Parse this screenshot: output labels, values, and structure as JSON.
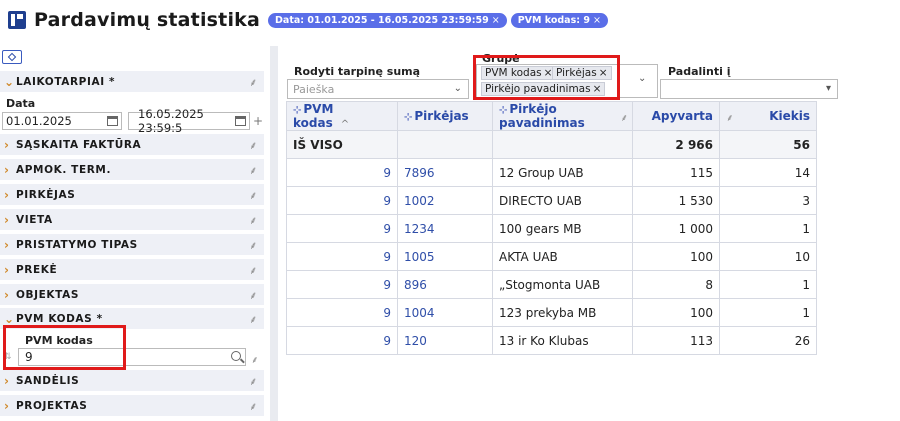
{
  "header": {
    "title": "Pardavimų statistika",
    "chips": [
      {
        "label": "Data: 01.01.2025 - 16.05.2025 23:59:59",
        "close": "×"
      },
      {
        "label": "PVM kodas: 9",
        "close": "×"
      }
    ]
  },
  "sidebar": {
    "categories": [
      {
        "label": "LAIKOTARPIAI *",
        "expanded": true
      },
      {
        "label": "SĄSKAITA FAKTŪRA",
        "expanded": false
      },
      {
        "label": "APMOK. TERM.",
        "expanded": false
      },
      {
        "label": "PIRKĖJAS",
        "expanded": false
      },
      {
        "label": "VIETA",
        "expanded": false
      },
      {
        "label": "PRISTATYMO TIPAS",
        "expanded": false
      },
      {
        "label": "PREKĖ",
        "expanded": false
      },
      {
        "label": "OBJEKTAS",
        "expanded": false
      },
      {
        "label": "PVM KODAS *",
        "expanded": true
      },
      {
        "label": "SANDĖLIS",
        "expanded": false
      },
      {
        "label": "PROJEKTAS",
        "expanded": false
      }
    ],
    "date": {
      "label": "Data",
      "from": "01.01.2025",
      "to": "16.05.2025 23:59:5"
    },
    "pvm": {
      "label": "PVM kodas",
      "value": "9"
    }
  },
  "controls": {
    "subtotal_label": "Rodyti tarpinę sumą",
    "subtotal_placeholder": "Paieška",
    "group_label": "Grupė",
    "group_chips": [
      "PVM kodas",
      "Pirkėjas",
      "Pirkėjo pavadinimas"
    ],
    "split_label": "Padalinti į",
    "split_value": ""
  },
  "table": {
    "columns": [
      "PVM kodas",
      "Pirkėjas",
      "Pirkėjo pavadinimas",
      "Apyvarta",
      "Kiekis"
    ],
    "total": {
      "label": "IŠ VISO",
      "apyvarta": "2 966",
      "kiekis": "56"
    },
    "rows": [
      {
        "pvm": "9",
        "pirkejas": "7896",
        "pavadinimas": "12 Group UAB",
        "apyvarta": "115",
        "kiekis": "14"
      },
      {
        "pvm": "9",
        "pirkejas": "1002",
        "pavadinimas": "DIRECTO UAB",
        "apyvarta": "1 530",
        "kiekis": "3"
      },
      {
        "pvm": "9",
        "pirkejas": "1234",
        "pavadinimas": "100 gears MB",
        "apyvarta": "1 000",
        "kiekis": "1"
      },
      {
        "pvm": "9",
        "pirkejas": "1005",
        "pavadinimas": "AKTA UAB",
        "apyvarta": "100",
        "kiekis": "10"
      },
      {
        "pvm": "9",
        "pirkejas": "896",
        "pavadinimas": "„Stogmonta UAB",
        "apyvarta": "8",
        "kiekis": "1"
      },
      {
        "pvm": "9",
        "pirkejas": "1004",
        "pavadinimas": "123 prekyba MB",
        "apyvarta": "100",
        "kiekis": "1"
      },
      {
        "pvm": "9",
        "pirkejas": "120",
        "pavadinimas": "13 ir Ko Klubas",
        "apyvarta": "113",
        "kiekis": "26"
      }
    ]
  },
  "colors": {
    "chip": "#5a6ee8",
    "link": "#2f4ea8",
    "highlight": "#e01a1a",
    "category_chevron": "#d08a2c"
  }
}
